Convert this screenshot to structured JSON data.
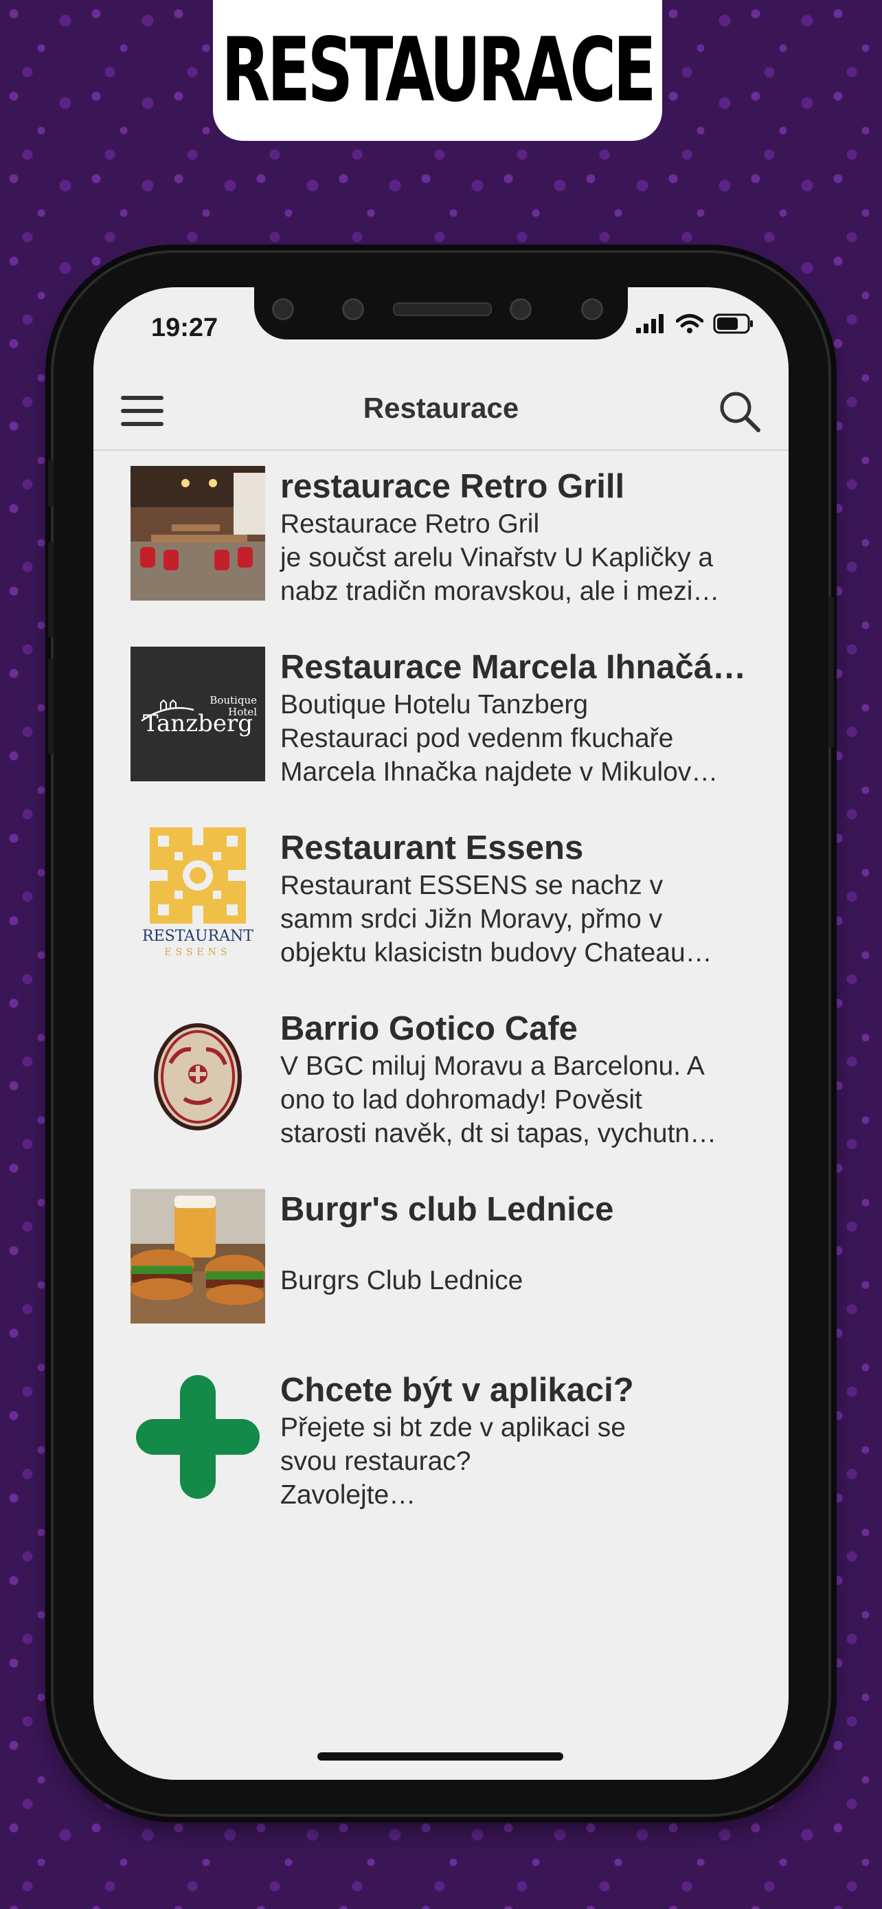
{
  "banner": {
    "title": "RESTAURACE"
  },
  "status_bar": {
    "time": "19:27"
  },
  "header": {
    "title": "Restaurace"
  },
  "items": [
    {
      "title": "restaurace Retro Grill",
      "desc": "Restaurace Retro Gril\nje součst arelu Vinařstv U Kapličky a\nnabz tradičn moravskou, ale i mezi…",
      "thumb": "restaurant-interior-photo"
    },
    {
      "title": "Restaurace Marcela Ihnačá…",
      "desc": " Boutique Hotelu Tanzberg\nRestauraci pod vedenm fkuchaře\nMarcela Ihnačka najdete v Mikulov…",
      "thumb": "tanzberg-logo",
      "logo_text": {
        "small1": "Boutique",
        "small2": "Hotel",
        "name": "Tanzberg"
      }
    },
    {
      "title": "Restaurant Essens",
      "desc": "Restaurant ESSENS se nachz v\nsamm srdci Jižn Moravy, přmo v\nobjektu klasicistn budovy Chateau…",
      "thumb": "essens-logo",
      "logo_text": {
        "name": "RESTAURANT",
        "sub": "ESSENS"
      }
    },
    {
      "title": "Barrio Gotico Cafe",
      "desc": "V BGC miluj Moravu a Barcelonu. A\nono to lad dohromady! Pověsit\nstarosti navěk, dt si tapas, vychutn…",
      "thumb": "barrio-gotico-logo"
    },
    {
      "title": "Burgr's club Lednice",
      "desc": "\nBurgrs Club Lednice",
      "thumb": "burger-photo"
    },
    {
      "title": "Chcete být v aplikaci?",
      "desc": "Přejete si bt zde v aplikaci se\nsvou restaurac?\nZavolejte…",
      "thumb": "plus-icon"
    }
  ],
  "colors": {
    "background": "#3a1656",
    "plus": "#138a48"
  }
}
